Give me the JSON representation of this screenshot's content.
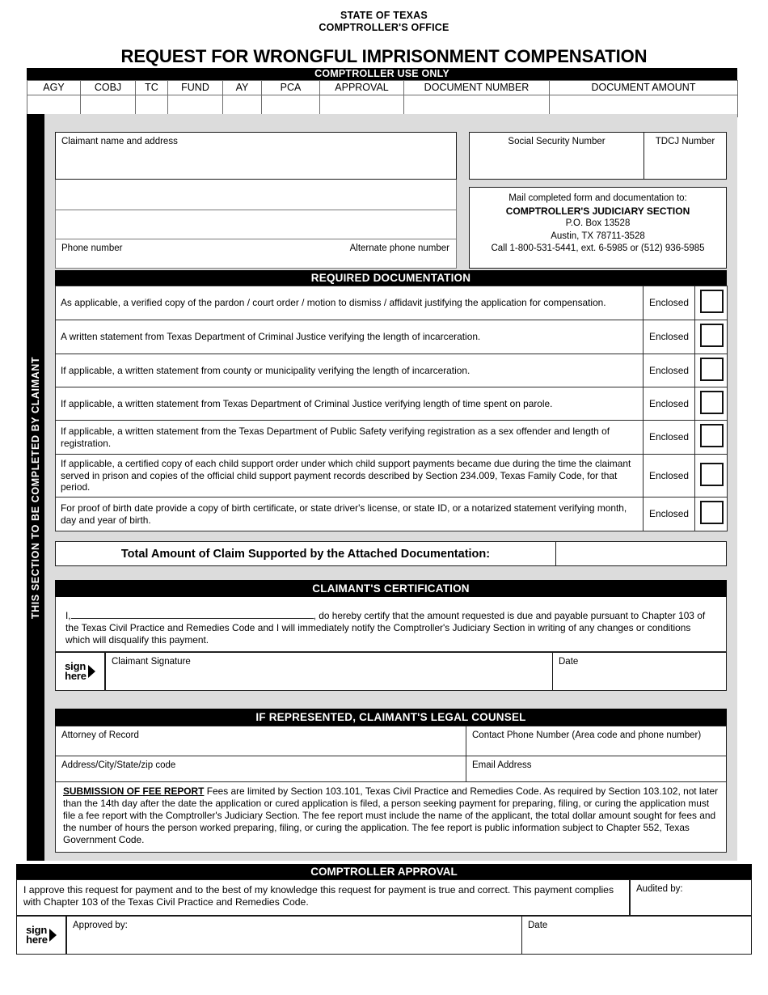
{
  "header": {
    "state": "STATE OF TEXAS",
    "office": "COMPTROLLER'S OFFICE",
    "title": "REQUEST FOR WRONGFUL IMPRISONMENT COMPENSATION"
  },
  "comptroller_use": {
    "bar_label": "COMPTROLLER USE ONLY",
    "columns": [
      "AGY",
      "COBJ",
      "TC",
      "FUND",
      "AY",
      "PCA",
      "APPROVAL",
      "DOCUMENT NUMBER",
      "DOCUMENT AMOUNT"
    ],
    "values": [
      "",
      "",
      "",
      "",
      "",
      "",
      "",
      "",
      ""
    ]
  },
  "sidebar": {
    "label": "THIS SECTION TO BE COMPLETED BY CLAIMANT"
  },
  "claimant": {
    "name_address_label": "Claimant name and address",
    "name_address_value": "",
    "address_line2_value": "",
    "address_line3_value": "",
    "phone_label": "Phone number",
    "phone_value": "",
    "alt_phone_label": "Alternate phone number",
    "alt_phone_value": "",
    "ssn_label": "Social Security Number",
    "ssn_value": "",
    "tdcj_label": "TDCJ Number",
    "tdcj_value": ""
  },
  "mailing": {
    "intro": "Mail completed form and documentation to:",
    "section": "COMPTROLLER'S JUDICIARY SECTION",
    "po_box": "P.O. Box 13528",
    "city_state_zip": "Austin, TX 78711-3528",
    "phone": "Call 1-800-531-5441, ext. 6-5985 or (512) 936-5985"
  },
  "required_documentation": {
    "bar_label": "REQUIRED DOCUMENTATION",
    "enclosed_label": "Enclosed",
    "rows": [
      {
        "text": "As applicable, a verified copy of the pardon / court order / motion to dismiss / affidavit justifying the application for compensation.",
        "enclosed": "Enclosed",
        "checked": false
      },
      {
        "text": "A written statement from Texas Department of Criminal Justice verifying the length of incarceration.",
        "enclosed": "Enclosed",
        "checked": false
      },
      {
        "text": "If applicable, a written statement from county or municipality verifying the length of incarceration.",
        "enclosed": "Enclosed",
        "checked": false
      },
      {
        "text": "If applicable, a written statement from Texas Department of Criminal Justice verifying length of time spent on parole.",
        "enclosed": "Enclosed",
        "checked": false
      },
      {
        "text": "If applicable, a written statement from the Texas Department of Public Safety verifying registration as a sex offender and length of registration.",
        "enclosed": "Enclosed",
        "checked": false
      },
      {
        "text": "If applicable, a certified copy of each child support order under which child support payments became due during the time the claimant served in prison and copies of the official child support payment records described by Section 234.009, Texas Family Code, for that period.",
        "enclosed": "Enclosed",
        "checked": false
      },
      {
        "text": "For proof of birth date provide a copy of birth certificate, or state driver's license, or state ID, or a notarized statement verifying month, day and year of birth.",
        "enclosed": "Enclosed",
        "checked": false
      }
    ]
  },
  "total": {
    "label": "Total Amount of Claim Supported by the Attached Documentation:",
    "value": ""
  },
  "certification": {
    "bar_label": "CLAIMANT'S CERTIFICATION",
    "lead_in": "I,",
    "name_value": "",
    "body": ", do hereby certify that the amount requested is due and payable pursuant to Chapter 103 of the Texas Civil Practice and Remedies Code and I will immediately notify the Comptroller's Judiciary Section in writing of any changes or conditions which will disqualify this payment.",
    "sign_here_line1": "sign",
    "sign_here_line2": "here",
    "signature_label": "Claimant Signature",
    "signature_value": "",
    "date_label": "Date",
    "date_value": ""
  },
  "legal_counsel": {
    "bar_label": "IF REPRESENTED, CLAIMANT'S LEGAL COUNSEL",
    "attorney_label": "Attorney of Record",
    "attorney_value": "",
    "phone_label": "Contact Phone Number (Area code and phone number)",
    "phone_value": "",
    "address_label": "Address/City/State/zip code",
    "address_value": "",
    "email_label": "Email Address",
    "email_value": ""
  },
  "fee_report": {
    "heading": "SUBMISSION OF FEE REPORT",
    "body": " Fees are limited by Section 103.101, Texas Civil Practice and Remedies Code. As required by Section 103.102, not later than the 14th day after the date the application or cured application is filed, a person seeking payment for preparing, filing, or curing the application must file a fee report with the Comptroller's Judiciary Section. The fee report must include the name of the applicant, the total dollar amount sought for fees and the number of hours the person worked preparing, filing, or curing the application. The fee report is public information subject to Chapter 552, Texas Government Code."
  },
  "comptroller_approval": {
    "bar_label": "COMPTROLLER APPROVAL",
    "statement": "I approve this request for payment and to the best of my knowledge this request for payment is true and correct. This payment complies with Chapter 103 of the Texas Civil Practice and Remedies Code.",
    "audited_by_label": "Audited by:",
    "audited_by_value": "",
    "sign_here_line1": "sign",
    "sign_here_line2": "here",
    "approved_by_label": "Approved by:",
    "approved_by_value": "",
    "date_label": "Date",
    "date_value": ""
  },
  "colors": {
    "panel_background": "#dcdcdc",
    "bar_background": "#000000",
    "bar_text": "#ffffff",
    "page_background": "#ffffff",
    "border": "#1a1a1a"
  }
}
